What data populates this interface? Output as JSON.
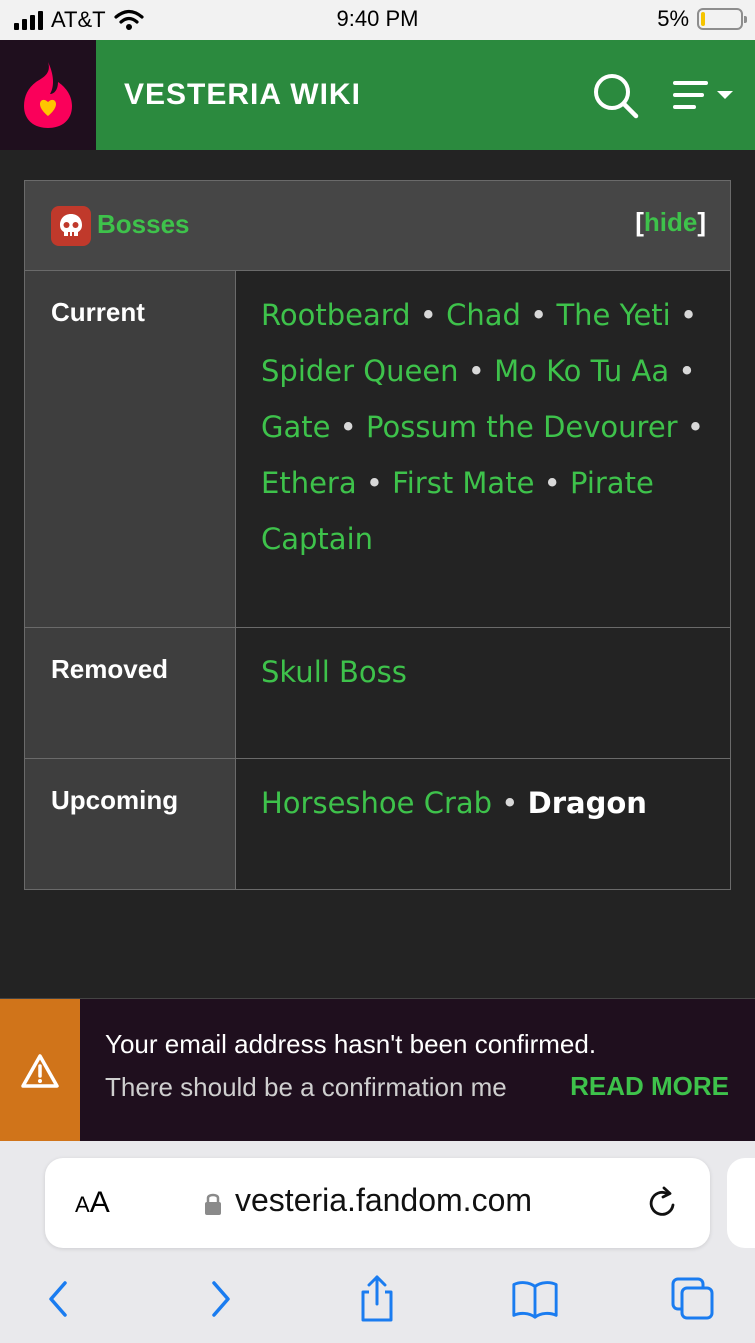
{
  "status_bar": {
    "carrier": "AT&T",
    "time": "9:40 PM",
    "battery": "5%"
  },
  "header": {
    "title": "VESTERIA WIKI"
  },
  "navbox": {
    "title": "Bosses",
    "hide_open": "[",
    "hide_label": "hide",
    "hide_close": "]",
    "rows": [
      {
        "group": "Current",
        "items": [
          "Rootbeard",
          "Chad",
          "The Yeti",
          "Spider Queen",
          "Mo Ko Tu Aa",
          "Gate",
          "Possum the Devourer",
          "Ethera",
          "First Mate",
          "Pirate Captain"
        ]
      },
      {
        "group": "Removed",
        "items": [
          "Skull Boss"
        ]
      },
      {
        "group": "Upcoming",
        "items": [
          "Horseshoe Crab"
        ],
        "current_item": "Dragon"
      }
    ],
    "separator": " • "
  },
  "banner": {
    "line1": "Your email address hasn't been confirmed.",
    "line2": "There should be a confirmation me",
    "read_more": "READ MORE"
  },
  "safari": {
    "aa_small": "A",
    "aa_large": "A",
    "url": "vesteria.fandom.com"
  },
  "colors": {
    "accent_green": "#3ec24b",
    "header_green": "#2b8a3e",
    "banner_orange": "#d0741a",
    "ios_blue": "#1a7cf0"
  },
  "icons": {
    "logo": "fandom-flame-icon",
    "search": "search-icon",
    "menu": "menu-icon",
    "skull": "skull-icon",
    "warning": "warning-icon",
    "lock": "lock-icon",
    "reload": "reload-icon",
    "back": "back-icon",
    "forward": "forward-icon",
    "share": "share-icon",
    "bookmarks": "bookmarks-icon",
    "tabs": "tabs-icon"
  }
}
